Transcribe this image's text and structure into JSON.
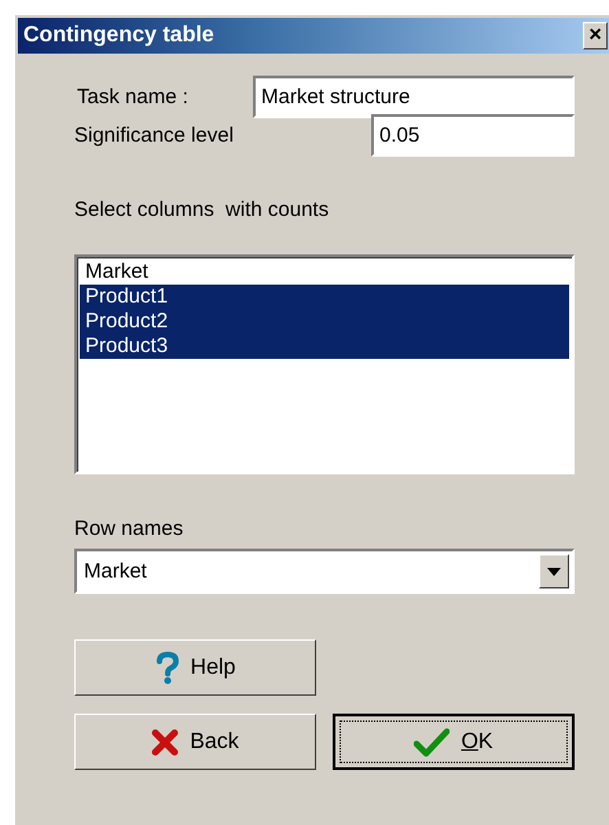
{
  "window": {
    "title": "Contingency table",
    "close": "×"
  },
  "task_name": {
    "label": "Task name :",
    "value": "Market structure"
  },
  "significance": {
    "label": "Significance level",
    "value": "0.05"
  },
  "columns": {
    "label": "Select columns  with counts",
    "items": [
      {
        "label": "Market",
        "selected": false
      },
      {
        "label": "Product1",
        "selected": true
      },
      {
        "label": "Product2",
        "selected": true
      },
      {
        "label": "Product3",
        "selected": true
      }
    ]
  },
  "row_names": {
    "label": "Row names",
    "value": "Market"
  },
  "buttons": [
    {
      "kind": "help",
      "label": "Help",
      "default": false
    },
    {
      "kind": "back",
      "label": "Back",
      "default": false
    },
    {
      "kind": "ok",
      "label": "OK",
      "default": true
    }
  ]
}
